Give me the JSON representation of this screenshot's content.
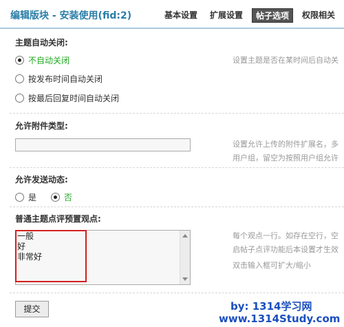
{
  "header": {
    "title": "编辑版块 - 安装使用(fid:2)",
    "tabs": [
      {
        "label": "基本设置",
        "active": false
      },
      {
        "label": "扩展设置",
        "active": false
      },
      {
        "label": "帖子选项",
        "active": true
      },
      {
        "label": "权限相关",
        "active": false
      }
    ]
  },
  "auto_close": {
    "title": "主题自动关闭:",
    "options": [
      {
        "label": "不自动关闭",
        "checked": true
      },
      {
        "label": "按发布时间自动关闭",
        "checked": false
      },
      {
        "label": "按最后回复时间自动关闭",
        "checked": false
      }
    ],
    "description": "设置主题是否在某时间后自动关"
  },
  "attachment_types": {
    "title": "允许附件类型:",
    "value": "",
    "description_lines": [
      "设置允许上传的附件扩展名，多",
      "用户组，留空为按照用户组允许"
    ]
  },
  "allow_post_dynamic": {
    "title": "允许发送动态:",
    "options": [
      {
        "label": "是",
        "checked": false
      },
      {
        "label": "否",
        "checked": true
      }
    ]
  },
  "rating_viewpoints": {
    "title": "普通主题点评预置观点:",
    "lines": [
      "一般",
      "好",
      "非常好"
    ],
    "description_lines": [
      "每个观点一行。如存在空行，空",
      "启帖子点评功能后本设置才生效",
      "双击输入框可扩大/缩小"
    ]
  },
  "submit_label": "提交",
  "watermark": {
    "line1": "by: 1314学习网",
    "line2": "www.1314Study.com"
  },
  "colors": {
    "title": "#2a7da8",
    "active_tab_bg": "#555555",
    "checked_label": "#22aa22",
    "highlight_box": "#d21f1f",
    "watermark": "#1b4fbf"
  }
}
